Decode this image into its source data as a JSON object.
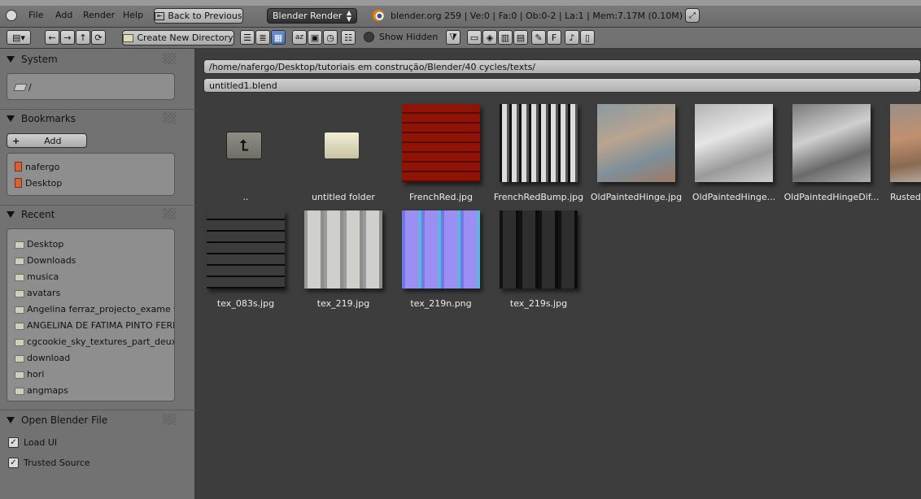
{
  "menubar": {
    "items": [
      "File",
      "Add",
      "Render",
      "Help"
    ],
    "back_label": "Back to Previous",
    "engine": "Blender Render",
    "stats": "blender.org 259 | Ve:0 | Fa:0 | Ob:0-2 | La:1 | Mem:7.17M (0.10M)"
  },
  "toolbar": {
    "create_dir_label": "Create New Directory",
    "show_hidden_label": "Show Hidden"
  },
  "sidebar": {
    "system": {
      "title": "System",
      "items": [
        "/"
      ]
    },
    "bookmarks": {
      "title": "Bookmarks",
      "add_label": "Add",
      "items": [
        "nafergo",
        "Desktop"
      ]
    },
    "recent": {
      "title": "Recent",
      "items": [
        "Desktop",
        "Downloads",
        "musica",
        "avatars",
        "Angelina ferraz_projecto_exame fin",
        "ANGELINA DE FATIMA PINTO FERR",
        "cgcookie_sky_textures_part_deux",
        "download",
        "hori",
        "angmaps"
      ]
    },
    "open_blend": {
      "title": "Open Blender File",
      "load_ui": "Load UI",
      "trusted_source": "Trusted Source"
    }
  },
  "browser": {
    "path": "/home/nafergo/Desktop/tutoriais em construção/Blender/40 cycles/texts/",
    "filename": "untitled1.blend",
    "files": [
      {
        "name": "..",
        "kind": "parent-folder"
      },
      {
        "name": "untitled folder",
        "kind": "folder"
      },
      {
        "name": "FrenchRed.jpg",
        "kind": "tile-red"
      },
      {
        "name": "FrenchRedBump.jpg",
        "kind": "tile-bump"
      },
      {
        "name": "OldPaintedHinge.jpg",
        "kind": "hinge-color"
      },
      {
        "name": "OldPaintedHinge...",
        "kind": "hinge-gray"
      },
      {
        "name": "OldPaintedHingeDif...",
        "kind": "hinge-dark"
      },
      {
        "name": "RustedW",
        "kind": "rust"
      },
      {
        "name": "tex_083s.jpg",
        "kind": "bricks"
      },
      {
        "name": "tex_219.jpg",
        "kind": "panel-gray"
      },
      {
        "name": "tex_219n.png",
        "kind": "panel-normal"
      },
      {
        "name": "tex_219s.jpg",
        "kind": "panel-dark"
      }
    ]
  },
  "colors": {
    "selected_button": "#4772b3",
    "brick_red": "#b7442a",
    "normal_purple": "#8a7ee8"
  }
}
